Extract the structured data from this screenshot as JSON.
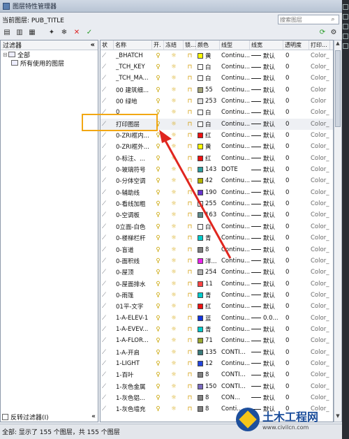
{
  "window": {
    "title": "图层特性管理器"
  },
  "current_layer": {
    "label": "当前图层: PUB_TITLE"
  },
  "search": {
    "placeholder": "搜索图层"
  },
  "filter_panel": {
    "header": "过滤器",
    "collapse": "«",
    "tree": [
      {
        "label": "全部",
        "level": 0
      },
      {
        "label": "所有使用的图层",
        "level": 1
      }
    ],
    "invert_label": "反转过滤器(I)"
  },
  "columns": [
    "状",
    "名称",
    "开.",
    "冻结",
    "锁...",
    "颜色",
    "线型",
    "线宽",
    "透明度",
    "打印..."
  ],
  "layers": [
    {
      "name": "_BHATCH",
      "color_hex": "#ffff00",
      "color": "黄",
      "linetype": "Continu...",
      "lineweight": "默认",
      "transparency": "0",
      "plot": "Color_"
    },
    {
      "name": "_TCH_KEY",
      "color_hex": "#ffffff",
      "color": "白",
      "linetype": "Continu...",
      "lineweight": "默认",
      "transparency": "0",
      "plot": "Color_"
    },
    {
      "name": "_TCH_MA...",
      "color_hex": "#ffffff",
      "color": "白",
      "linetype": "Continu...",
      "lineweight": "默认",
      "transparency": "0",
      "plot": "Color_"
    },
    {
      "name": "00 建筑细...",
      "color_hex": "#a7a77a",
      "color": "55",
      "linetype": "Continu...",
      "lineweight": "默认",
      "transparency": "0",
      "plot": "Color"
    },
    {
      "name": "00 绿地",
      "color_hex": "#e0e0e0",
      "color": "253",
      "linetype": "Continu...",
      "lineweight": "默认",
      "transparency": "0",
      "plot": "Color"
    },
    {
      "name": "0",
      "color_hex": "#ffffff",
      "color": "白",
      "linetype": "Continu...",
      "lineweight": "默认",
      "transparency": "0",
      "plot": "Color_"
    },
    {
      "name": "打印图层",
      "color_hex": "#ffffff",
      "color": "白",
      "linetype": "Continu...",
      "lineweight": "默认",
      "transparency": "0",
      "plot": "Color_",
      "highlight": true
    },
    {
      "name": "0-ZRI框内...",
      "color_hex": "#ee1111",
      "color": "红",
      "linetype": "Continu...",
      "lineweight": "默认",
      "transparency": "0",
      "plot": "Color_"
    },
    {
      "name": "0-ZRI框外...",
      "color_hex": "#ffff00",
      "color": "黄",
      "linetype": "Continu...",
      "lineweight": "默认",
      "transparency": "0",
      "plot": "Color_"
    },
    {
      "name": "0-标注、...",
      "color_hex": "#ee1111",
      "color": "红",
      "linetype": "Continu...",
      "lineweight": "默认",
      "transparency": "0",
      "plot": "Color_"
    },
    {
      "name": "0-玻璃符号",
      "color_hex": "#2e9f9f",
      "color": "143",
      "linetype": "DOTE",
      "lineweight": "默认",
      "transparency": "0",
      "plot": "Color_"
    },
    {
      "name": "0-分体空调",
      "color_hex": "#b3b300",
      "color": "42",
      "linetype": "Continu...",
      "lineweight": "默认",
      "transparency": "0",
      "plot": "Color_"
    },
    {
      "name": "0-辅助线",
      "color_hex": "#6633cc",
      "color": "190",
      "linetype": "Continu...",
      "lineweight": "默认",
      "transparency": "0",
      "plot": "Color_"
    },
    {
      "name": "0-看线加粗",
      "color_hex": "#f0f0f0",
      "color": "255",
      "linetype": "Continu...",
      "lineweight": "默认",
      "transparency": "0",
      "plot": "Color_"
    },
    {
      "name": "0-空调板",
      "color_hex": "#5c8a8a",
      "color": "163",
      "linetype": "Continu...",
      "lineweight": "默认",
      "transparency": "0",
      "plot": "Color_"
    },
    {
      "name": "0立面-白色",
      "color_hex": "#ffffff",
      "color": "白",
      "linetype": "Continu...",
      "lineweight": "默认",
      "transparency": "0",
      "plot": "Color_"
    },
    {
      "name": "0-楼梯栏杆",
      "color_hex": "#00cccc",
      "color": "青",
      "linetype": "Continu...",
      "lineweight": "默认",
      "transparency": "0",
      "plot": "Color_"
    },
    {
      "name": "0-盲道",
      "color_hex": "#808080",
      "color": "8",
      "linetype": "Continu...",
      "lineweight": "默认",
      "transparency": "0",
      "plot": "Color_"
    },
    {
      "name": "0-面积线",
      "color_hex": "#ee22ee",
      "color": "洋...",
      "linetype": "Continu...",
      "lineweight": "默认",
      "transparency": "0",
      "plot": "Color_"
    },
    {
      "name": "0-屋顶",
      "color_hex": "#b0b0b0",
      "color": "254",
      "linetype": "Continu...",
      "lineweight": "默认",
      "transparency": "0",
      "plot": "Color_"
    },
    {
      "name": "0-屋面排水",
      "color_hex": "#ff4444",
      "color": "11",
      "linetype": "Continu...",
      "lineweight": "默认",
      "transparency": "0",
      "plot": "Color_"
    },
    {
      "name": "0-雨篷",
      "color_hex": "#00cccc",
      "color": "青",
      "linetype": "Continu...",
      "lineweight": "默认",
      "transparency": "0",
      "plot": "Color_"
    },
    {
      "name": "01平-文字",
      "color_hex": "#ee1111",
      "color": "红",
      "linetype": "Continu...",
      "lineweight": "默认",
      "transparency": "0",
      "plot": "Color_"
    },
    {
      "name": "1-A-ELEV-1",
      "color_hex": "#1133dd",
      "color": "蓝",
      "linetype": "Continu...",
      "lineweight": "0.0...",
      "transparency": "0",
      "plot": "Color_"
    },
    {
      "name": "1-A-EVEV...",
      "color_hex": "#00cccc",
      "color": "青",
      "linetype": "Continu...",
      "lineweight": "默认",
      "transparency": "0",
      "plot": "Color_"
    },
    {
      "name": "1-A-FLOR...",
      "color_hex": "#9aa833",
      "color": "71",
      "linetype": "Continu...",
      "lineweight": "默认",
      "transparency": "0",
      "plot": "Color_"
    },
    {
      "name": "1-A-开启",
      "color_hex": "#3a7a7a",
      "color": "135",
      "linetype": "CONTI...",
      "lineweight": "默认",
      "transparency": "0",
      "plot": "Color_"
    },
    {
      "name": "1-LIGHT",
      "color_hex": "#2244dd",
      "color": "12",
      "linetype": "Continu...",
      "lineweight": "默认",
      "transparency": "0",
      "plot": "Color_"
    },
    {
      "name": "1-百叶",
      "color_hex": "#808080",
      "color": "8",
      "linetype": "CONTI...",
      "lineweight": "默认",
      "transparency": "0",
      "plot": "Color_"
    },
    {
      "name": "1-灰色金属",
      "color_hex": "#7a6abf",
      "color": "150",
      "linetype": "CONTI...",
      "lineweight": "默认",
      "transparency": "0",
      "plot": "Color_"
    },
    {
      "name": "1-灰色铝...",
      "color_hex": "#808080",
      "color": "8",
      "linetype": "CON...",
      "lineweight": "默认",
      "transparency": "0",
      "plot": "Color_"
    },
    {
      "name": "1-灰色墙充",
      "color_hex": "#808080",
      "color": "8",
      "linetype": "Conti...",
      "lineweight": "默认",
      "transparency": "0",
      "plot": "Color_"
    }
  ],
  "status": {
    "text": "全部: 显示了 155 个图层，共 155 个图层"
  },
  "watermark": {
    "title": "土木工程网",
    "url": "www.civilcn.com"
  }
}
